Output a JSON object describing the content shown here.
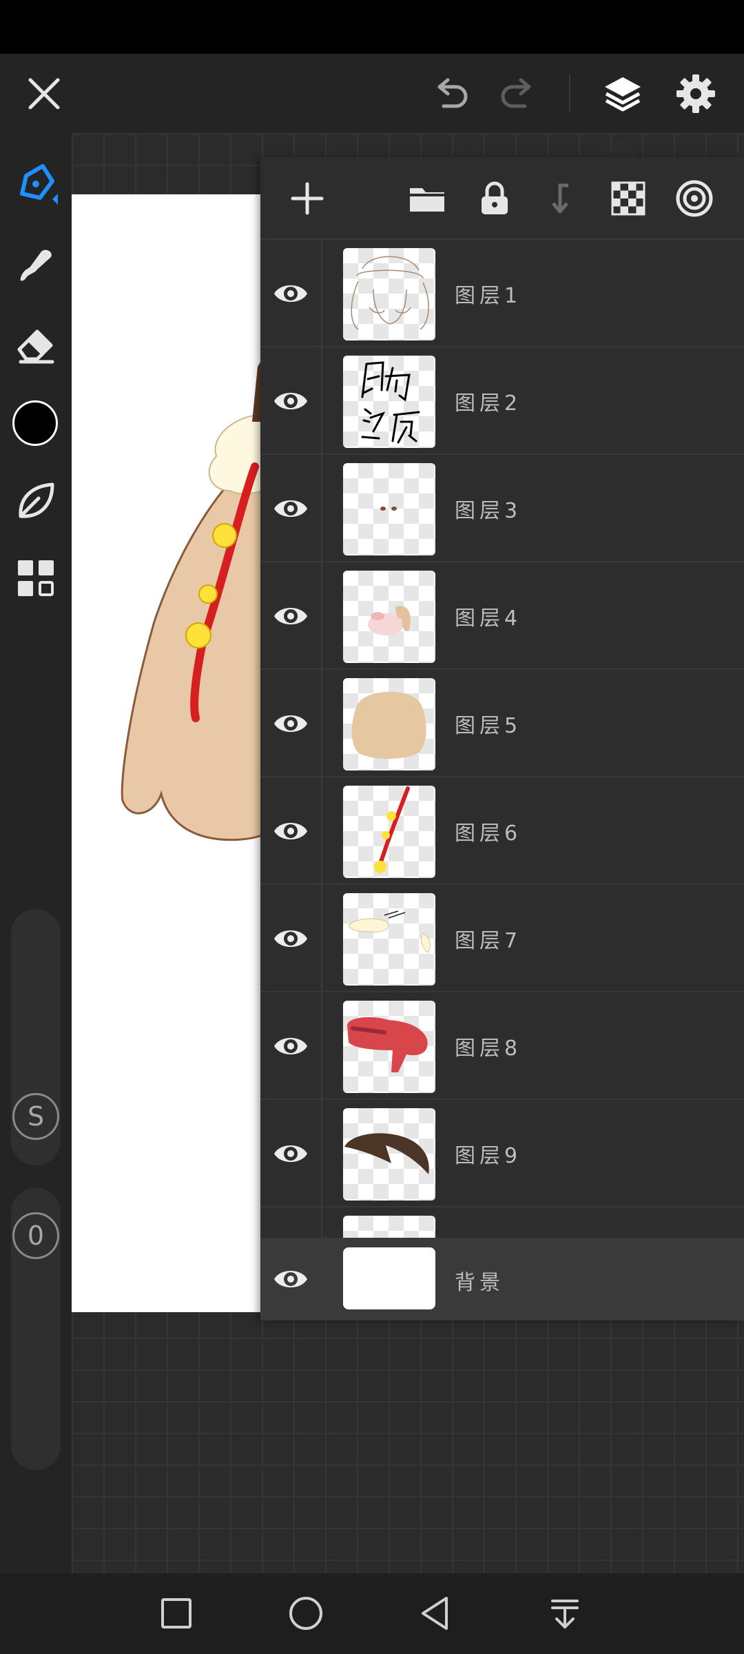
{
  "app": {
    "accent_color": "#1e90ff",
    "brush_color": "#000000"
  },
  "top_bar": {
    "icons": [
      "close-icon",
      "undo-icon",
      "redo-icon",
      "layers-icon",
      "settings-icon"
    ]
  },
  "left_toolbar": {
    "tools": [
      "pen-icon",
      "smudge-icon",
      "eraser-icon",
      "color-picker",
      "leaf-icon",
      "grid-icon"
    ],
    "size_badge": "S",
    "opacity_badge": "0"
  },
  "layers_panel": {
    "toolbar_icons": [
      "add-layer-icon",
      "folder-icon",
      "lock-icon",
      "merge-down-icon",
      "checkerboard-icon",
      "target-icon"
    ],
    "layers": [
      {
        "name": "图层1",
        "visible": true,
        "thumb": "sketch"
      },
      {
        "name": "图层2",
        "visible": true,
        "thumb": "text"
      },
      {
        "name": "图层3",
        "visible": true,
        "thumb": "eyes"
      },
      {
        "name": "图层4",
        "visible": true,
        "thumb": "blush"
      },
      {
        "name": "图层5",
        "visible": true,
        "thumb": "skin"
      },
      {
        "name": "图层6",
        "visible": true,
        "thumb": "ribbon"
      },
      {
        "name": "图层7",
        "visible": true,
        "thumb": "cream"
      },
      {
        "name": "图层8",
        "visible": true,
        "thumb": "red"
      },
      {
        "name": "图层9",
        "visible": true,
        "thumb": "brow"
      }
    ],
    "background_layer": {
      "name": "背景",
      "visible": true
    }
  },
  "nav_bar": {
    "icons": [
      "recent-apps-icon",
      "home-icon",
      "back-icon",
      "notification-pull-icon"
    ]
  }
}
